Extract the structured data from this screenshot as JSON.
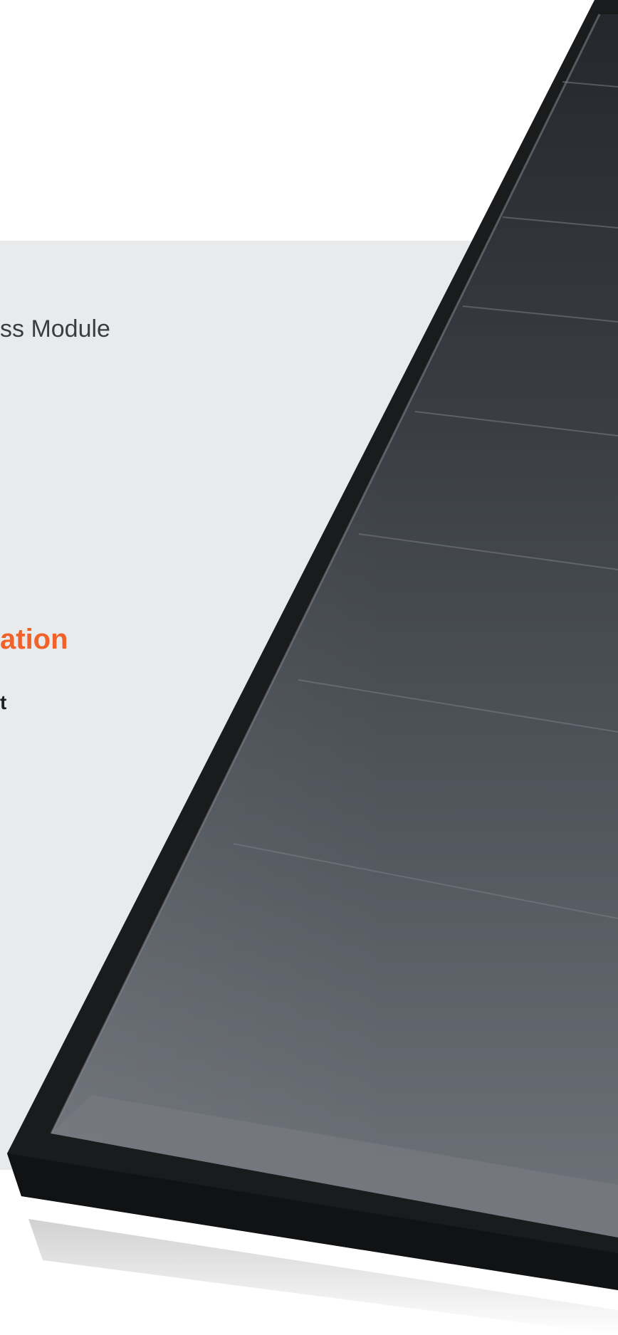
{
  "header": {
    "subtitle": "ss Module"
  },
  "section": {
    "heading": "ation",
    "fragment": "t"
  },
  "colors": {
    "accent": "#f0622a",
    "background_panel": "#e9eaec",
    "frame": "#1a1b1d",
    "cell_dark": "#2e3237",
    "cell_light": "#666a71"
  },
  "image": {
    "subject": "solar-panel-icon"
  }
}
